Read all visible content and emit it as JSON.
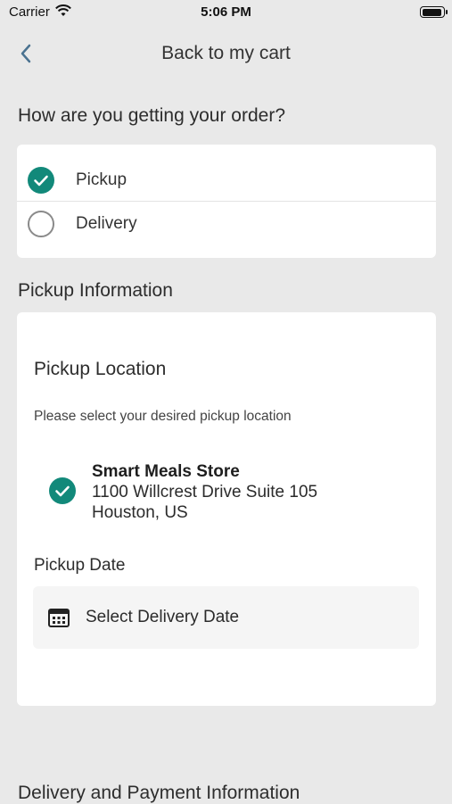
{
  "status_bar": {
    "carrier": "Carrier",
    "time": "5:06 PM",
    "wifi_icon": "wifi-icon",
    "battery_icon": "battery-icon"
  },
  "nav": {
    "title": "Back to my cart",
    "back_icon": "chevron-left-icon"
  },
  "order_method": {
    "heading": "How are you getting your order?",
    "options": [
      {
        "label": "Pickup",
        "selected": true
      },
      {
        "label": "Delivery",
        "selected": false
      }
    ]
  },
  "pickup_info": {
    "heading": "Pickup Information",
    "location_title": "Pickup Location",
    "location_hint": "Please select your desired pickup location",
    "store": {
      "name": "Smart Meals Store",
      "address_line1": "1100 Willcrest Drive Suite 105",
      "address_line2": "Houston, US",
      "selected": true
    },
    "date_label": "Pickup Date",
    "date_placeholder": "Select Delivery Date",
    "date_icon": "calendar-icon"
  },
  "delivery_payment": {
    "heading": "Delivery and Payment Information"
  },
  "colors": {
    "accent": "#12897a",
    "background": "#e9e9e9",
    "card": "#ffffff"
  }
}
